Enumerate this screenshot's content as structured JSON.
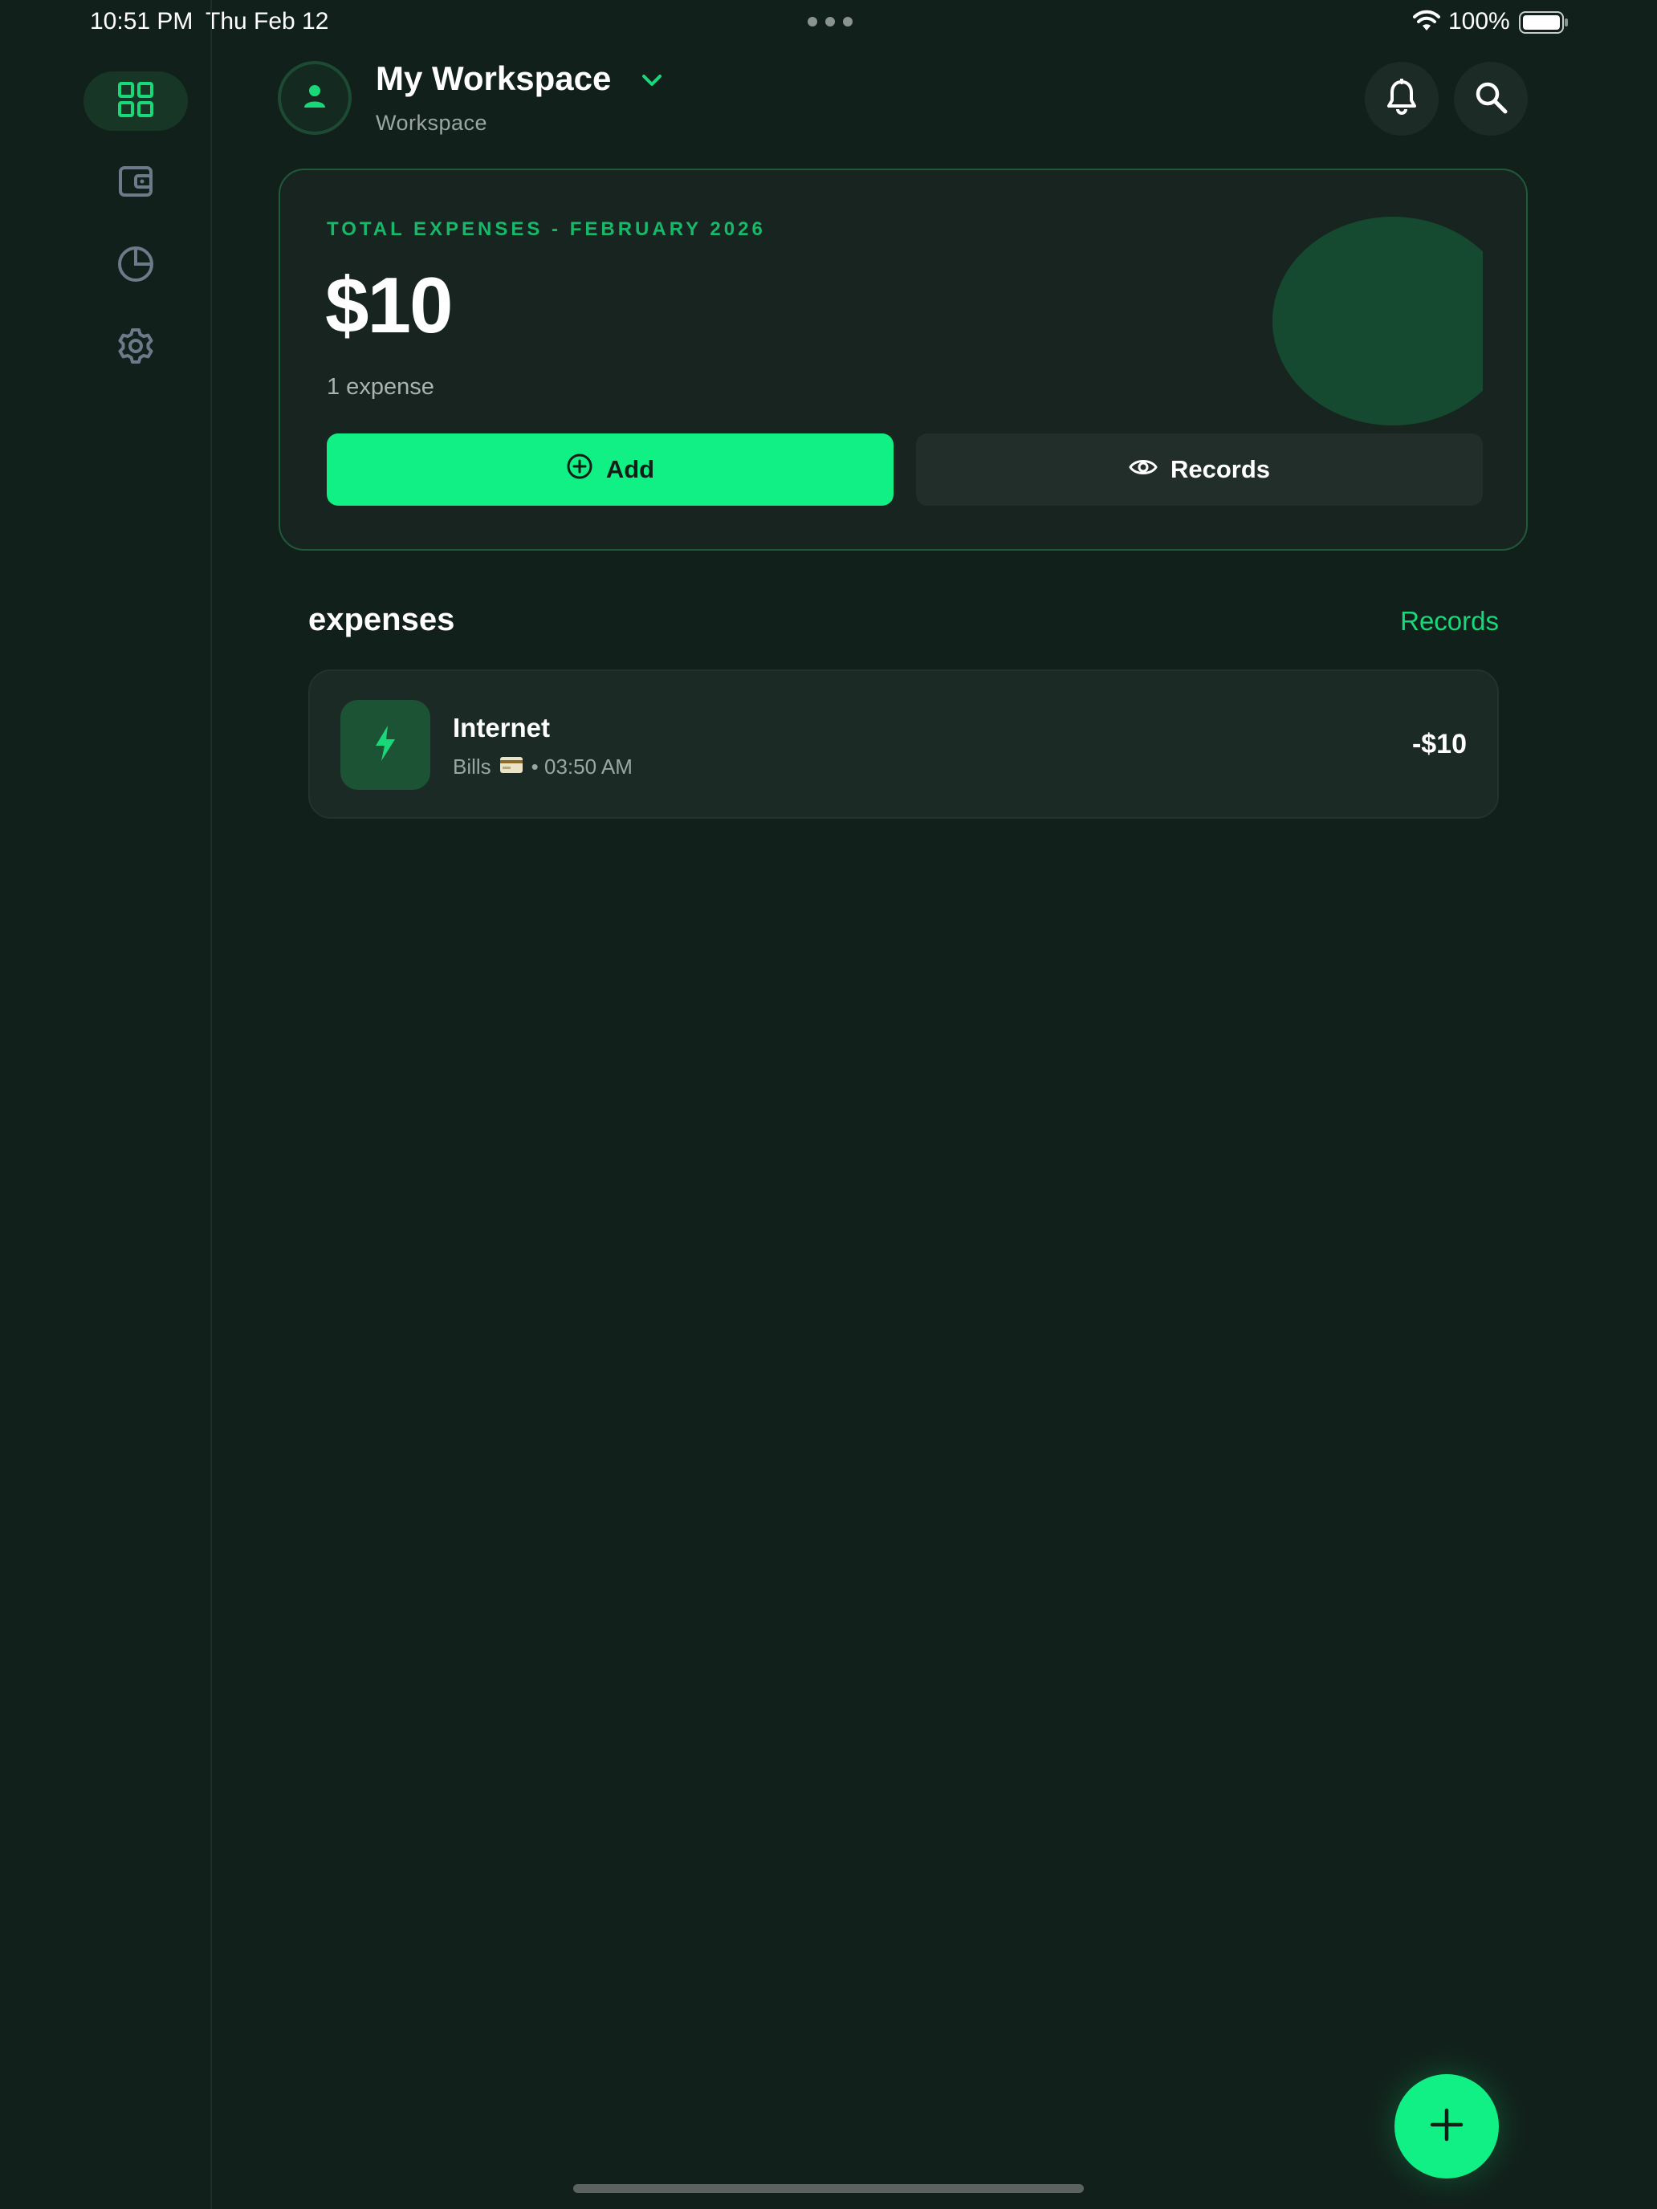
{
  "status_bar": {
    "time": "10:51 PM",
    "date": "Thu Feb 12",
    "battery_percent": "100%"
  },
  "sidebar": {
    "items": [
      {
        "icon": "dashboard-grid-icon",
        "active": true
      },
      {
        "icon": "wallet-icon",
        "active": false
      },
      {
        "icon": "pie-chart-icon",
        "active": false
      },
      {
        "icon": "gear-icon",
        "active": false
      }
    ]
  },
  "header": {
    "title": "My Workspace",
    "subtitle": "Workspace",
    "avatar_icon": "user-icon",
    "actions": [
      "bell-icon",
      "search-icon"
    ]
  },
  "summary": {
    "label": "TOTAL EXPENSES - FEBRUARY 2026",
    "amount": "$10",
    "count": "1 expense",
    "add_label": "Add",
    "records_label": "Records"
  },
  "expenses_section": {
    "title": "expenses",
    "link": "Records",
    "items": [
      {
        "icon": "lightning-icon",
        "name": "Internet",
        "category": "Bills",
        "category_icon": "credit-card-emoji",
        "time": "• 03:50 AM",
        "amount": "-$10"
      }
    ]
  },
  "colors": {
    "background": "#12201b",
    "accent": "#10f085",
    "accent_text": "#18b86a"
  }
}
